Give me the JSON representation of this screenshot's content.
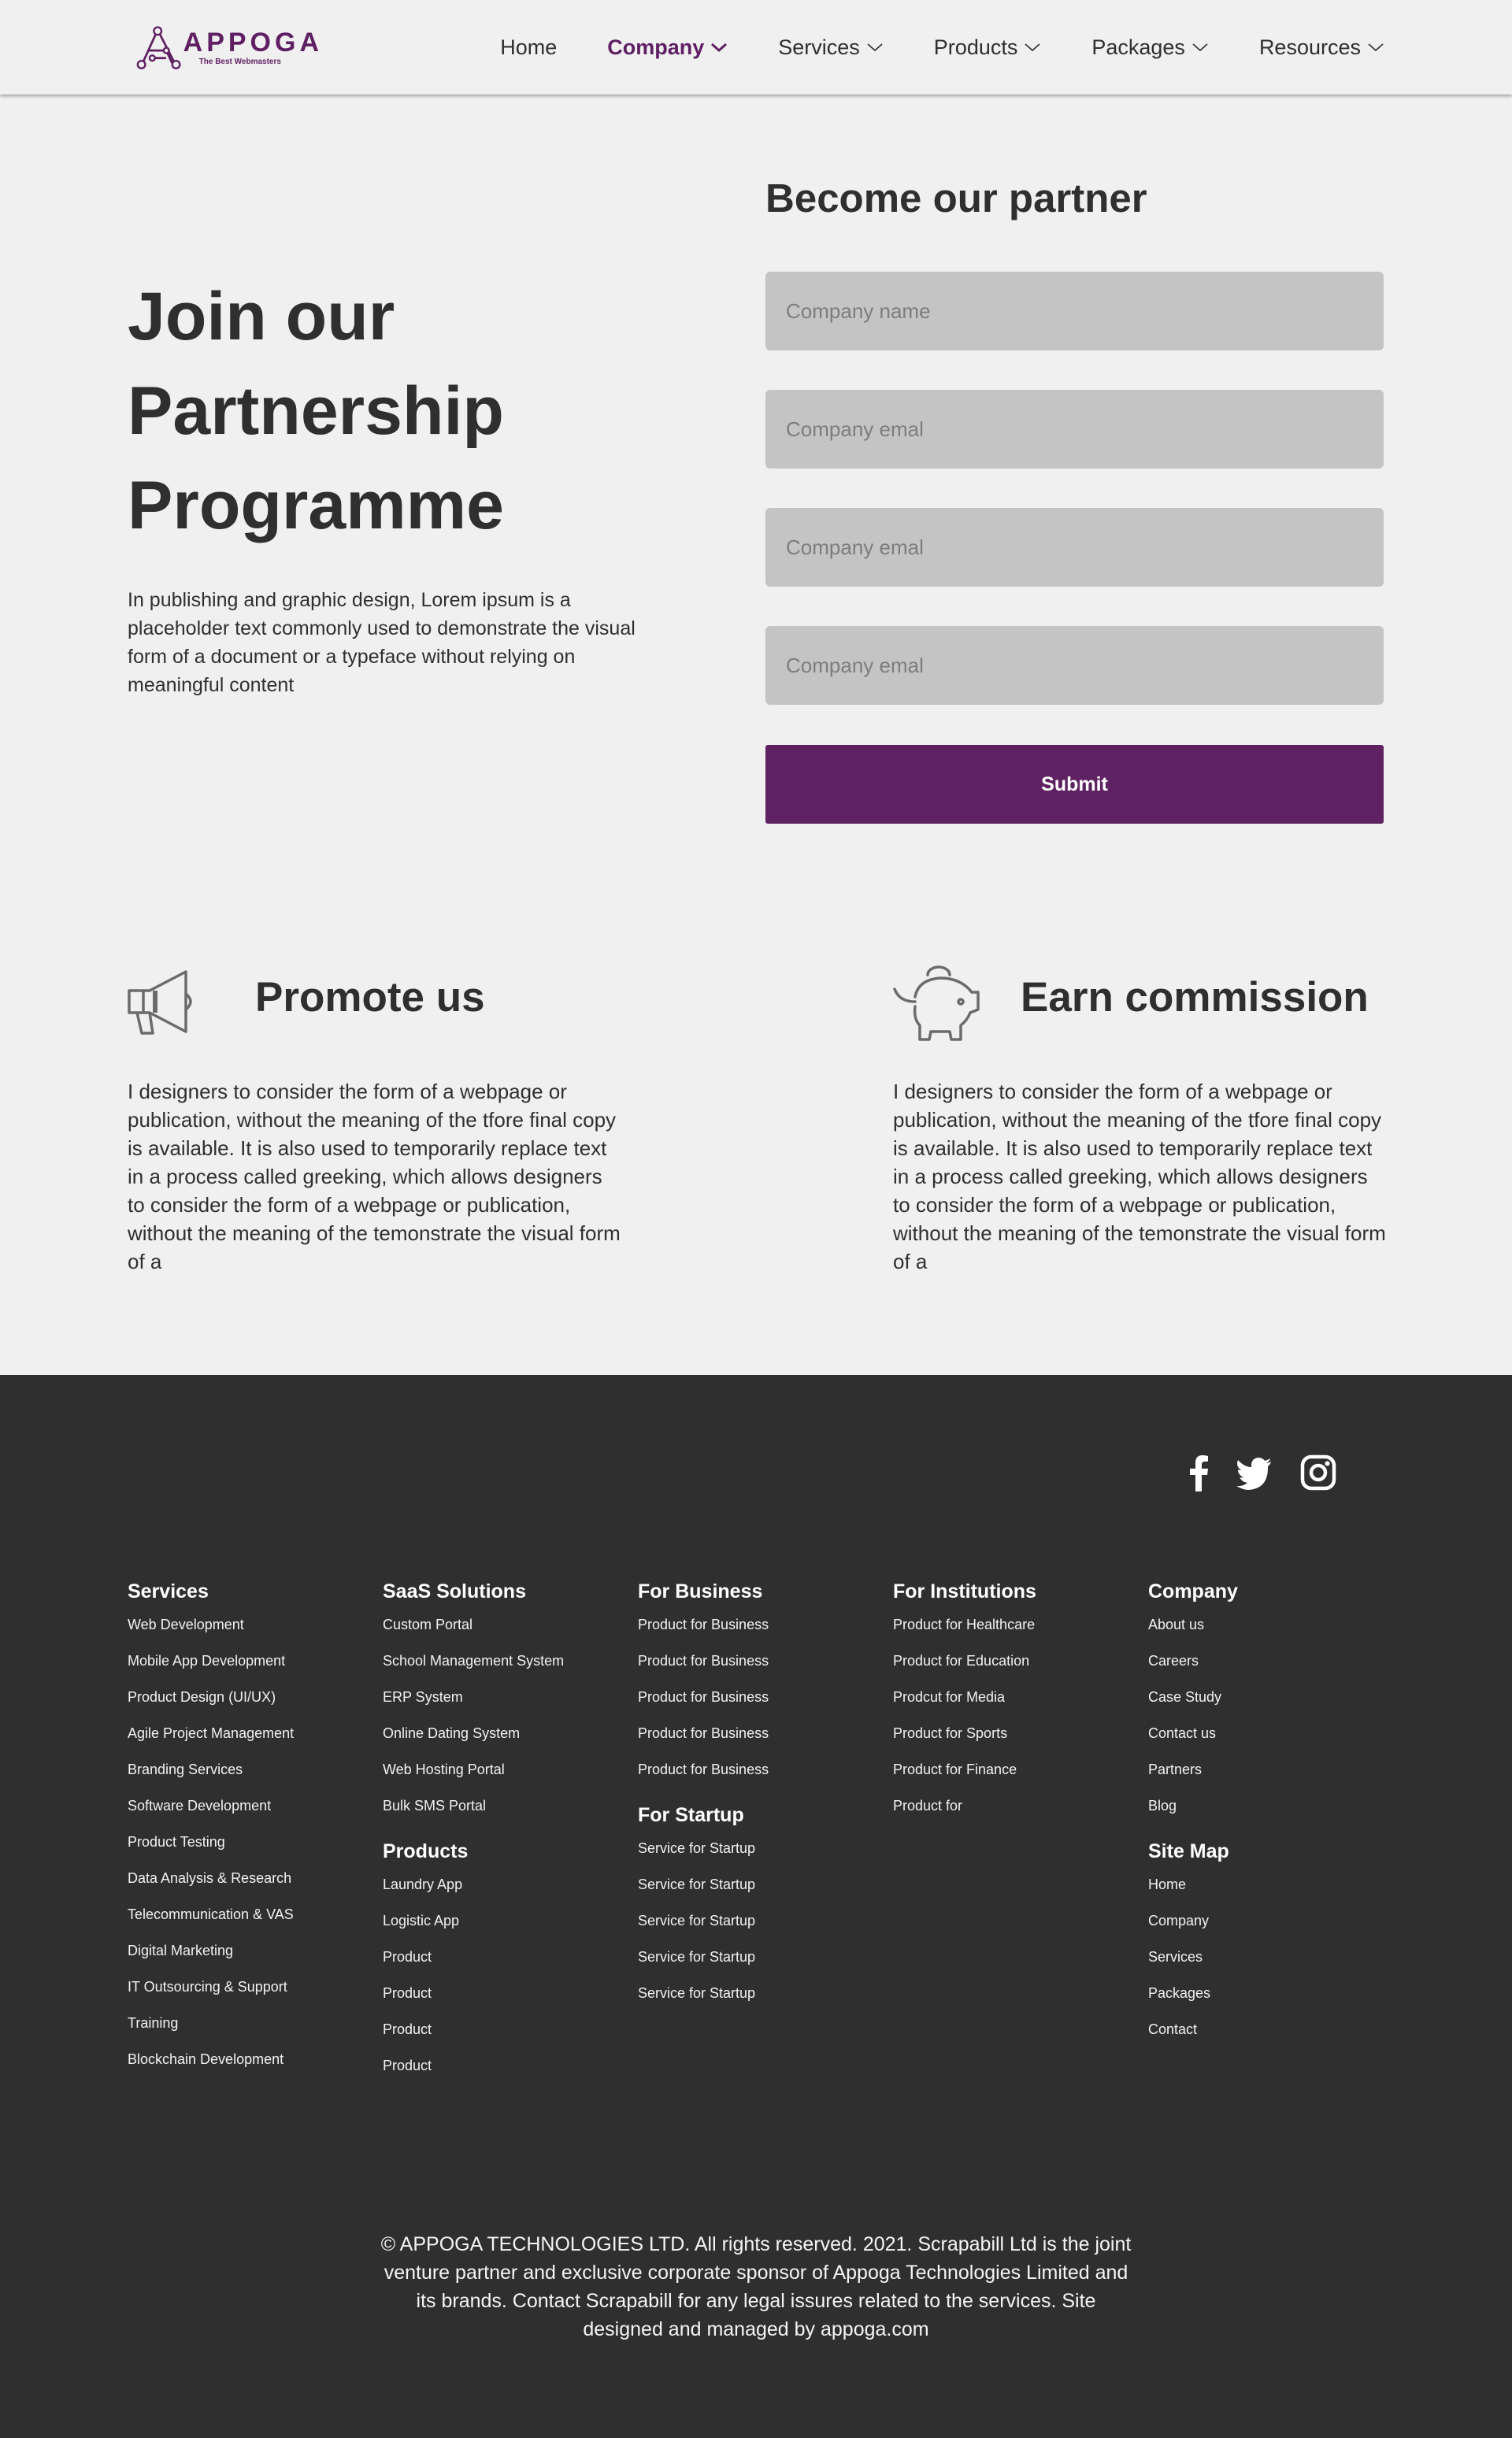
{
  "header": {
    "logo": {
      "name": "APPOGA",
      "tagline": "The Best Webmasters"
    },
    "nav": [
      {
        "label": "Home",
        "dropdown": false,
        "active": false
      },
      {
        "label": "Company",
        "dropdown": true,
        "active": true
      },
      {
        "label": "Services",
        "dropdown": true,
        "active": false
      },
      {
        "label": "Products",
        "dropdown": true,
        "active": false
      },
      {
        "label": "Packages",
        "dropdown": true,
        "active": false
      },
      {
        "label": "Resources",
        "dropdown": true,
        "active": false
      }
    ]
  },
  "hero": {
    "title_lines": [
      "Join our",
      "Partnership",
      "Programme"
    ],
    "description": "In publishing and graphic design, Lorem ipsum is a placeholder text commonly used to demonstrate the visual form of a document or a typeface without relying on meaningful content"
  },
  "form": {
    "title": "Become our partner",
    "fields": [
      {
        "placeholder": "Company name",
        "value": ""
      },
      {
        "placeholder": "Company emal",
        "value": ""
      },
      {
        "placeholder": "Company emal",
        "value": ""
      },
      {
        "placeholder": "Company emal",
        "value": ""
      }
    ],
    "submit_label": "Submit"
  },
  "features": [
    {
      "icon": "megaphone-icon",
      "title": "Promote us",
      "text": "I designers to consider the form of a webpage or publication, without the meaning of the tfore final copy is available. It is also used to temporarily replace text in a process called greeking, which allows designers to consider the form of a webpage or publication, without the meaning of the temonstrate the visual form of a"
    },
    {
      "icon": "piggy-bank-icon",
      "title": "Earn commission",
      "text": "I designers to consider the form of a webpage or publication, without the meaning of the tfore final copy is available. It is also used to temporarily replace text in a process called greeking, which allows designers to consider the form of a webpage or publication, without the meaning of the temonstrate the visual form of a"
    }
  ],
  "footer": {
    "social": [
      "facebook-icon",
      "twitter-icon",
      "instagram-icon"
    ],
    "columns": [
      {
        "sections": [
          {
            "heading": "Services",
            "links": [
              "Web Development",
              "Mobile App Development",
              "Product Design (UI/UX)",
              "Agile Project Management",
              "Branding Services",
              "Software Development",
              "Product Testing",
              "Data Analysis & Research",
              "Telecommunication & VAS",
              "Digital Marketing",
              "IT Outsourcing & Support",
              "Training",
              "Blockchain Development"
            ]
          }
        ]
      },
      {
        "sections": [
          {
            "heading": "SaaS Solutions",
            "links": [
              "Custom Portal",
              "School Management System",
              "ERP System",
              "Online Dating System",
              "Web Hosting Portal",
              "Bulk SMS Portal"
            ]
          },
          {
            "heading": "Products",
            "links": [
              "Laundry App",
              "Logistic App",
              "Product",
              "Product",
              "Product",
              "Product"
            ]
          }
        ]
      },
      {
        "sections": [
          {
            "heading": "For Business",
            "links": [
              "Product for Business",
              "Product for Business",
              "Product for Business",
              "Product for Business",
              "Product for Business"
            ]
          },
          {
            "heading": "For Startup",
            "links": [
              "Service for Startup",
              "Service for Startup",
              "Service for Startup",
              "Service for Startup",
              "Service for Startup"
            ]
          }
        ]
      },
      {
        "sections": [
          {
            "heading": "For Institutions",
            "links": [
              "Product for Healthcare",
              "Product for Education",
              "Prodcut for Media",
              "Product for Sports",
              "Product for Finance",
              "Product for"
            ]
          }
        ]
      },
      {
        "sections": [
          {
            "heading": "Company",
            "links": [
              "About us",
              "Careers",
              "Case Study",
              "Contact us",
              "Partners",
              "Blog"
            ]
          },
          {
            "heading": "Site Map",
            "links": [
              "Home",
              "Company",
              "Services",
              "Packages",
              "Contact"
            ]
          }
        ]
      }
    ],
    "copyright": "© APPOGA TECHNOLOGIES LTD. All rights reserved. 2021. Scrapabill Ltd is the joint venture partner and exclusive corporate sponsor of Appoga Technologies Limited and its brands. Contact Scrapabill for any legal issures related to the services. Site designed and managed by appoga.com"
  },
  "colors": {
    "brand": "#5e2262",
    "background": "#f0f0f0",
    "footer": "#2f2f2f",
    "input": "#c4c4c4",
    "text": "#2f2f2f"
  }
}
